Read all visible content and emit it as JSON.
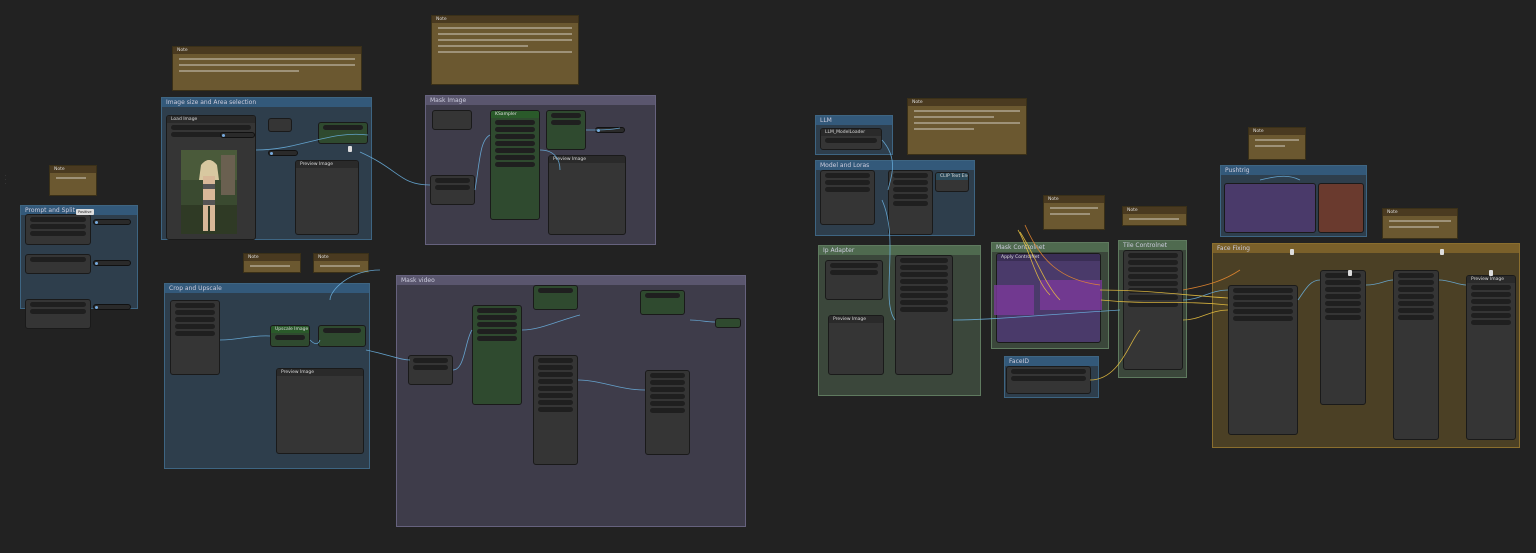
{
  "app": {
    "name": "ComfyUI workflow canvas"
  },
  "groups": {
    "prompt_split": "Prompt and Split",
    "image_size": "Image size and Area selection",
    "mask_image": "Mask Image",
    "crop_upscale": "Crop and Upscale",
    "mask_video": "Mask video",
    "llm": "LLM",
    "model_loras": "Model and Loras",
    "ip_adapter": "Ip Adapter",
    "mask_controlnet": "Mask Controlnet",
    "tile_controlnet": "Tile Controlnet",
    "faceid": "FaceID",
    "face_fixing": "Face Fixing",
    "empty_group": "Pushtrig"
  },
  "nodes": {
    "load_image": "Load Image",
    "positive_prompt_badge": "Positive",
    "preview_image": "Preview Image",
    "upscale_model": "Upscale Image",
    "llm_loader": "LLM_ModelLoader",
    "clip_text": "CLIP Text Encode",
    "ksampler": "KSampler",
    "vae_decode": "VAE Decode",
    "controlnet_apply": "Apply ControlNet",
    "image_preview_face": "Preview Image",
    "note": "Note"
  },
  "notes": {
    "title": "Note",
    "small_text": "Set your Instructions here",
    "comment_box_text": "Note"
  },
  "photo": {
    "alt": "woman in bikini standing in jungle ruins"
  },
  "colors": {
    "blue_group": "#33597a",
    "purple_group": "#5a566e",
    "green_group": "#4f6a4f",
    "olive_group": "#7a602a",
    "wire_blue": "#6cb4e4",
    "wire_yellow": "#e8c040",
    "wire_orange": "#e88830"
  }
}
